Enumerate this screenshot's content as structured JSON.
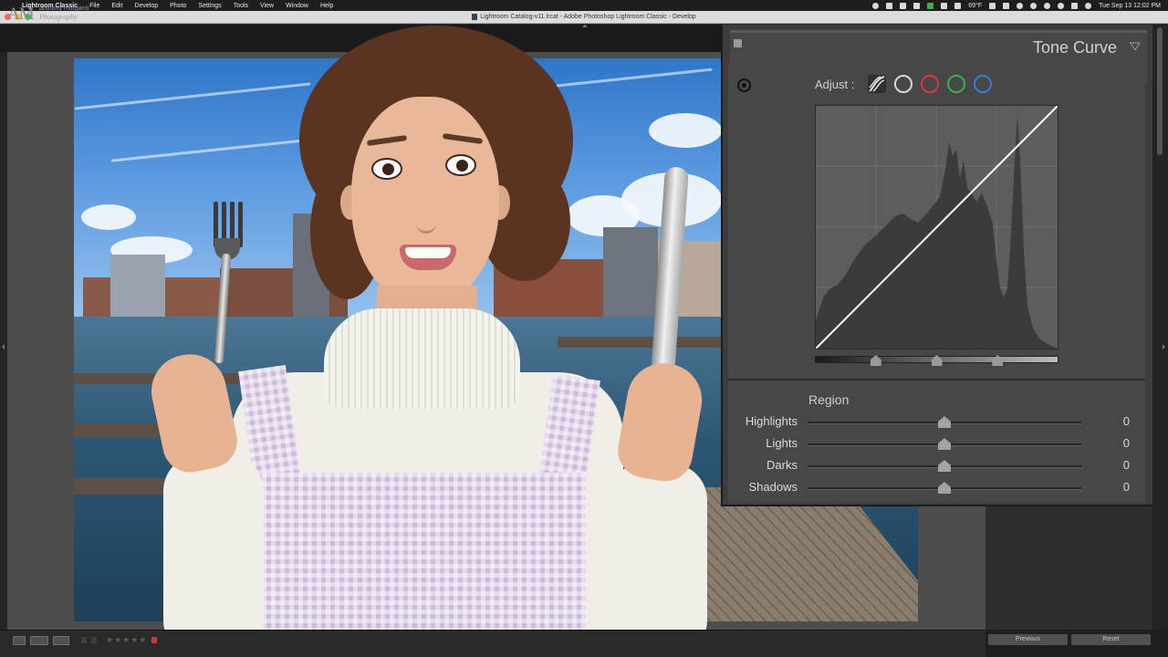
{
  "menubar": {
    "app_name": "Lightroom Classic",
    "items": [
      "File",
      "Edit",
      "Develop",
      "Photo",
      "Settings",
      "Tools",
      "View",
      "Window",
      "Help"
    ],
    "temperature": "69°F",
    "clock": "Tue Sep 13  12:02 PM"
  },
  "window": {
    "title": "Lightroom Catalog-v11.lrcat - Adobe Photoshop Lightroom Classic - Develop"
  },
  "identity_plate": {
    "initials": "AM",
    "name": "anthony morganti",
    "subtitle": "Photography"
  },
  "tone_curve": {
    "title": "Tone Curve",
    "adjust_label": "Adjust :",
    "channels": [
      {
        "name": "rgb",
        "color": "#d8d8d8"
      },
      {
        "name": "red",
        "color": "#e0343a"
      },
      {
        "name": "green",
        "color": "#3fae49"
      },
      {
        "name": "blue",
        "color": "#2f7de1"
      }
    ],
    "split_points": [
      0.25,
      0.5,
      0.75
    ],
    "region_label": "Region",
    "sliders": [
      {
        "label": "Highlights",
        "value": "0",
        "position": 0.5
      },
      {
        "label": "Lights",
        "value": "0",
        "position": 0.5
      },
      {
        "label": "Darks",
        "value": "0",
        "position": 0.5
      },
      {
        "label": "Shadows",
        "value": "0",
        "position": 0.5
      }
    ]
  },
  "bottom_buttons": {
    "previous": "Previous",
    "reset": "Reset"
  },
  "rating_stars": "★★★★★",
  "colors": {
    "panel_bg": "#474747",
    "workspace_bg": "#4d4d4d",
    "accent_label": "#cfcfcf"
  }
}
